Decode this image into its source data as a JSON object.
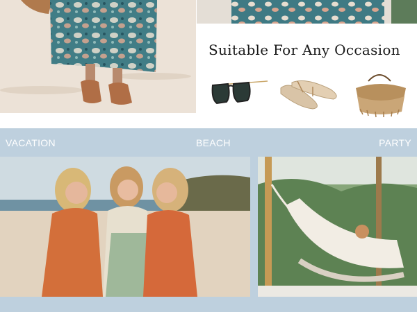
{
  "headline": "Suitable For Any Occasion",
  "occasions": {
    "vacation": "VACATION",
    "beach": "BEACH",
    "party": "PARTY"
  },
  "colors": {
    "band": "#bed0de",
    "label_text": "#ffffff",
    "headline_text": "#1a1a1a"
  },
  "icons": {
    "sunglasses": "sunglasses-icon",
    "sandals": "sandals-icon",
    "straw_bag": "straw-bag-icon"
  }
}
